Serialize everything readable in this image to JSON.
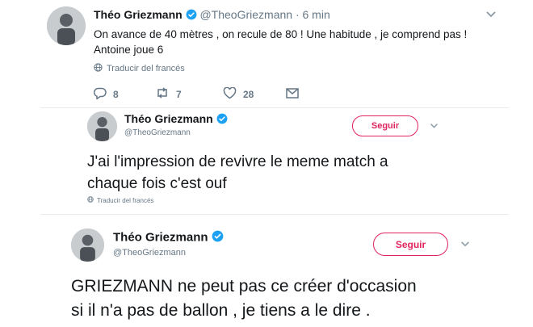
{
  "tweet1": {
    "name": "Théo Griezmann",
    "handle": "@TheoGriezmann",
    "time": "· 6 min",
    "text_line1": "On avance de 40 mètres , on recule de 80 ! Une habitude , je comprend pas !",
    "text_line2": "Antoine joue 6",
    "translate": "Traducir del francés",
    "replies": "8",
    "retweets": "7",
    "likes": "28"
  },
  "tweet2": {
    "name": "Théo Griezmann",
    "handle": "@TheoGriezmann",
    "follow_label": "Seguir",
    "text_line1": "J'ai l'impression de revivre le meme  match a",
    "text_line2": "chaque fois c'est ouf",
    "translate": "Traducir del francés"
  },
  "tweet3": {
    "name": "Théo Griezmann",
    "handle": "@TheoGriezmann",
    "follow_label": "Seguir",
    "text_line1": "GRIEZMANN ne peut pas ce créer d'occasion",
    "text_line2": "si il n'a pas de ballon , je tiens a le dire ."
  },
  "colors": {
    "verified": "#1da1f2",
    "follow": "#e0245e",
    "muted": "#657786"
  }
}
